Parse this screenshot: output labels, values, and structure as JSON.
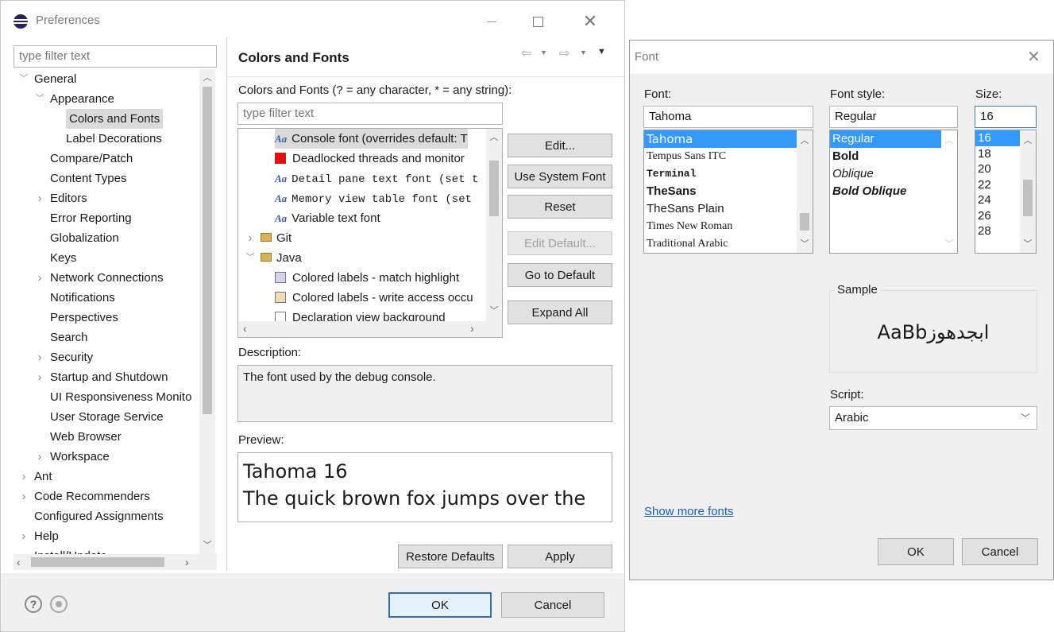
{
  "preferences": {
    "title": "Preferences",
    "filter_placeholder": "type filter text",
    "tree": [
      {
        "label": "General",
        "chevron": "down"
      },
      {
        "label": "Appearance",
        "chevron": "down"
      },
      {
        "label": "Colors and Fonts",
        "selected": true
      },
      {
        "label": "Label Decorations"
      },
      {
        "label": "Compare/Patch"
      },
      {
        "label": "Content Types"
      },
      {
        "label": "Editors",
        "chevron": "right"
      },
      {
        "label": "Error Reporting"
      },
      {
        "label": "Globalization"
      },
      {
        "label": "Keys"
      },
      {
        "label": "Network Connections",
        "chevron": "right"
      },
      {
        "label": "Notifications"
      },
      {
        "label": "Perspectives"
      },
      {
        "label": "Search"
      },
      {
        "label": "Security",
        "chevron": "right"
      },
      {
        "label": "Startup and Shutdown",
        "chevron": "right"
      },
      {
        "label": "UI Responsiveness Monito"
      },
      {
        "label": "User Storage Service"
      },
      {
        "label": "Web Browser"
      },
      {
        "label": "Workspace",
        "chevron": "right"
      },
      {
        "label": "Ant",
        "chevron": "right"
      },
      {
        "label": "Code Recommenders",
        "chevron": "right"
      },
      {
        "label": "Configured Assignments"
      },
      {
        "label": "Help",
        "chevron": "right"
      },
      {
        "label": "Install/Update",
        "chevron": "right"
      }
    ],
    "page_title": "Colors and Fonts",
    "description_prompt": "Colors and Fonts (? = any character, * = any string):",
    "inner_filter_placeholder": "type filter text",
    "color_tree": [
      {
        "label": "Console font (overrides default: T",
        "kind": "font",
        "selected": true
      },
      {
        "label": "Deadlocked threads and monitor",
        "kind": "color",
        "color": "#e01010"
      },
      {
        "label": "Detail pane text font (set t",
        "kind": "font",
        "mono": true
      },
      {
        "label": "Memory view table font (set",
        "kind": "font",
        "mono": true
      },
      {
        "label": "Variable text font",
        "kind": "font"
      },
      {
        "label": "Git",
        "kind": "category",
        "chevron": "right"
      },
      {
        "label": "Java",
        "kind": "category",
        "chevron": "down"
      },
      {
        "label": "Colored labels - match highlight",
        "kind": "color",
        "color": "#d4d4f0"
      },
      {
        "label": "Colored labels - write access occu",
        "kind": "color",
        "color": "#f0dcb4"
      },
      {
        "label": "Declaration view background",
        "kind": "color",
        "color": "#ffffff"
      }
    ],
    "side_buttons": [
      {
        "label": "Edit...",
        "disabled": false
      },
      {
        "label": "Use System Font",
        "disabled": false
      },
      {
        "label": "Reset",
        "disabled": false
      },
      {
        "label": "Edit Default...",
        "disabled": true
      },
      {
        "label": "Go to Default",
        "disabled": false
      },
      {
        "label": "Expand All",
        "disabled": false
      }
    ],
    "description_label": "Description:",
    "description_text": "The font used by the debug console.",
    "preview_label": "Preview:",
    "preview_lines": [
      "Tahoma 16",
      "The quick brown fox jumps over the"
    ],
    "restore_defaults_label": "Restore Defaults",
    "apply_label": "Apply",
    "ok_label": "OK",
    "cancel_label": "Cancel"
  },
  "font_dialog": {
    "title": "Font",
    "font_label": "Font:",
    "font_value": "Tahoma",
    "font_list": [
      "Tahoma",
      "Tempus Sans ITC",
      "Terminal",
      "TheSans",
      "TheSans Plain",
      "Times New Roman",
      "Traditional Arabic"
    ],
    "style_label": "Font style:",
    "style_value": "Regular",
    "style_list": [
      "Regular",
      "Bold",
      "Oblique",
      "Bold Oblique"
    ],
    "size_label": "Size:",
    "size_value": "16",
    "size_list": [
      "16",
      "18",
      "20",
      "22",
      "24",
      "26",
      "28"
    ],
    "sample_label": "Sample",
    "sample_text": "AaBbابجدهوز",
    "script_label": "Script:",
    "script_value": "Arabic",
    "show_more_label": "Show more fonts",
    "ok_label": "OK",
    "cancel_label": "Cancel"
  },
  "colors": {
    "accent": "#3399ff",
    "link": "#1a5fb4"
  }
}
